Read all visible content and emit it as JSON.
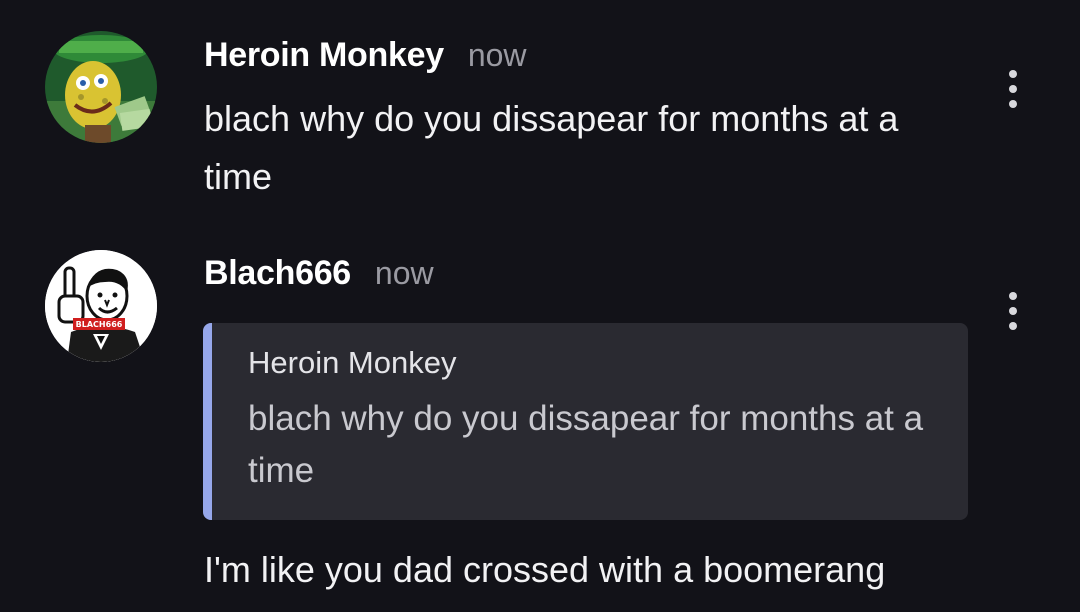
{
  "messages": [
    {
      "author": "Heroin Monkey",
      "timestamp": "now",
      "text": "blach why do you dissapear for months at a time",
      "avatar_icon": "spongebob-money-avatar",
      "menu_icon": "more-vertical-icon"
    },
    {
      "author": "Blach666",
      "timestamp": "now",
      "reply_to": {
        "author": "Heroin Monkey",
        "text": "blach why do you dissapear for months at a time"
      },
      "text": "I'm like you dad crossed with a boomerang",
      "avatar_icon": "middle-finger-man-avatar",
      "avatar_caption": "BLACH666",
      "menu_icon": "more-vertical-icon"
    }
  ],
  "colors": {
    "background": "#121218",
    "quote_background": "#2a2a31",
    "quote_accent": "#96a7ea",
    "timestamp": "#9a9aa2"
  }
}
